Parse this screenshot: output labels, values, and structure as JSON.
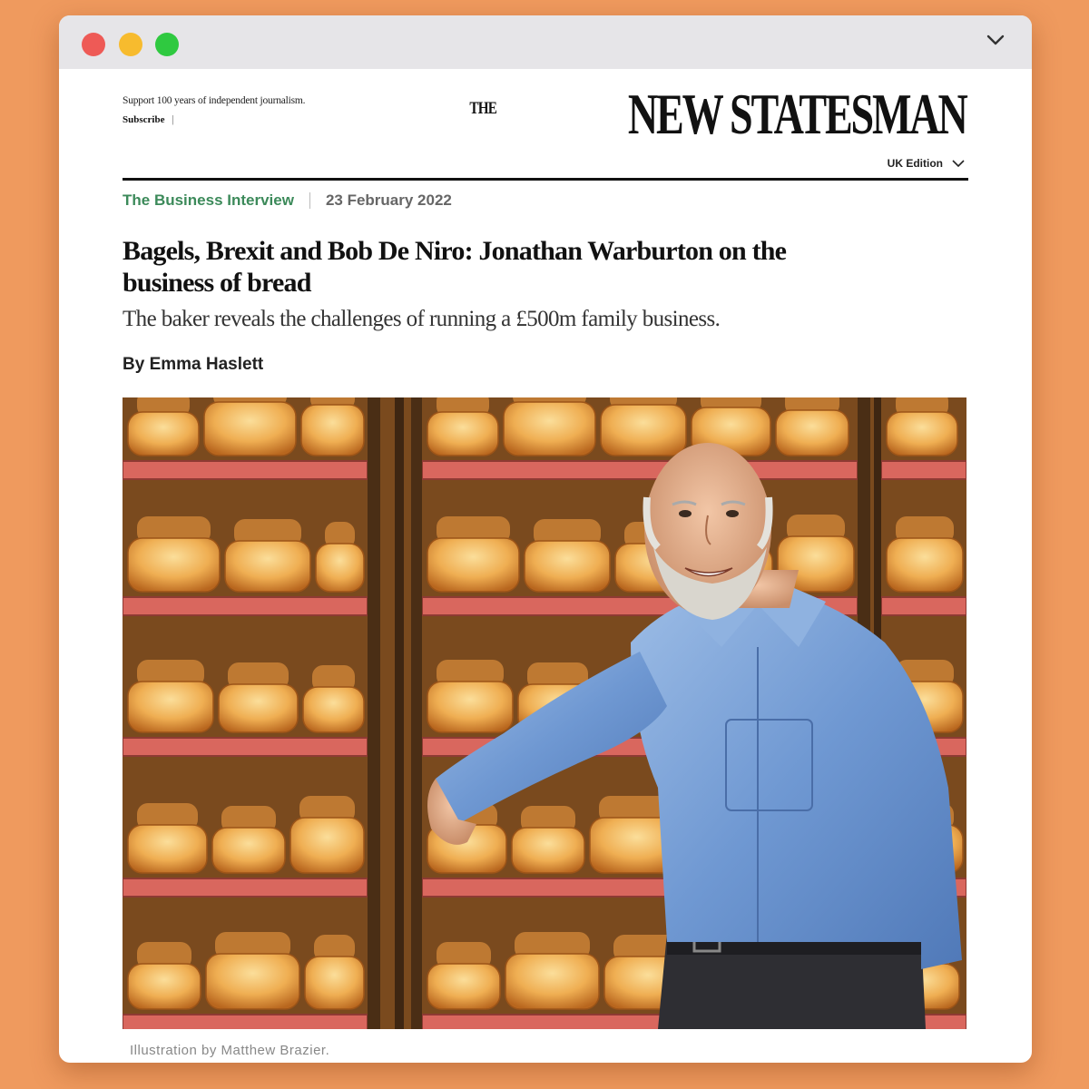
{
  "window": {
    "controls": [
      "close-dot",
      "minimize-dot",
      "maximize-dot"
    ],
    "menu_icon": "chevron-down-icon"
  },
  "header": {
    "support_text": "Support 100 years of independent journalism.",
    "subscribe_label": "Subscribe",
    "subscribe_separator": "|",
    "logo_the": "THE",
    "logo_main": "NEW STATESMAN",
    "edition_label": "UK Edition"
  },
  "article": {
    "category": "The Business Interview",
    "date": "23 February 2022",
    "headline": "Bagels, Brexit and Bob De Niro: Jonathan Warburton on the business of bread",
    "standfirst": "The baker reveals the challenges of running a £500m family business.",
    "byline": "By Emma Haslett",
    "image_caption": "Illustration by Matthew Brazier."
  },
  "colors": {
    "background": "#EF9A5E",
    "category_green": "#3C8A5A",
    "shelf_red": "#D9675E",
    "bread": "#E8A048",
    "shirt_blue": "#7EA6D9"
  }
}
